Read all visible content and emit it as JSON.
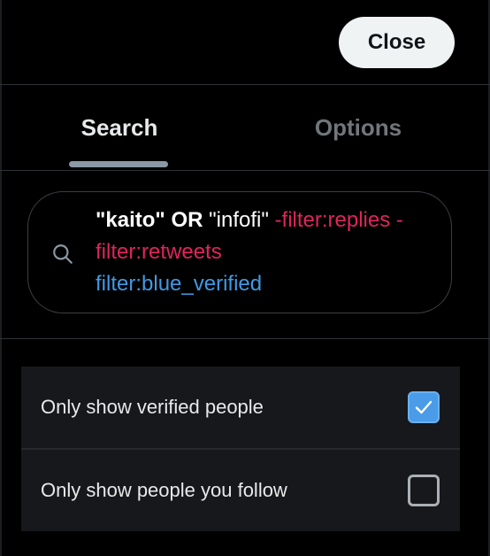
{
  "header": {
    "close_label": "Close"
  },
  "tabs": [
    {
      "label": "Search",
      "active": true
    },
    {
      "label": "Options",
      "active": false
    }
  ],
  "search": {
    "icon": "search-icon",
    "query_parts": {
      "kaito": "\"kaito\"",
      "or": "OR",
      "infofi": "\"infofi\"",
      "filter_replies": "-filter:replies",
      "filter_retweets": "-filter:retweets",
      "filter_verified": "filter:blue_verified"
    }
  },
  "options": [
    {
      "label": "Only show verified people",
      "checked": true
    },
    {
      "label": "Only show people you follow",
      "checked": false
    }
  ],
  "colors": {
    "background": "#000000",
    "accent_blue": "#3f9ae6",
    "accent_pink": "#e0245e",
    "checkbox_checked": "#4a9be8"
  }
}
